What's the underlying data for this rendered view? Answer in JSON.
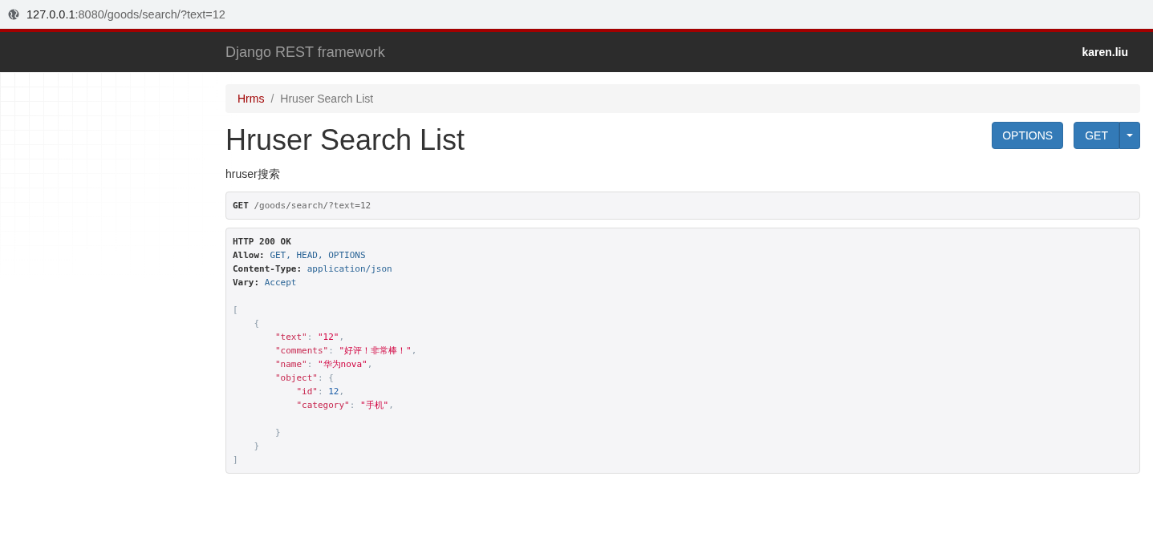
{
  "address_bar": {
    "host": "127.0.0.1",
    "path": ":8080/goods/search/?text=12"
  },
  "navbar": {
    "brand": "Django REST framework",
    "user": "karen.liu"
  },
  "breadcrumb": {
    "separator": "/",
    "items": [
      {
        "label": "Hrms",
        "selected": false
      },
      {
        "label": "Hruser Search List",
        "selected": true
      }
    ]
  },
  "page": {
    "title": "Hruser Search List",
    "description": "hruser搜索"
  },
  "buttons": [
    {
      "label": "OPTIONS",
      "kind": "plain"
    },
    {
      "label": "GET",
      "kind": "split"
    }
  ],
  "request": {
    "method": "GET",
    "path": "/goods/search/?text=12"
  },
  "response": {
    "status": "HTTP 200 OK",
    "headers": [
      {
        "name": "Allow:",
        "value": "GET, HEAD, OPTIONS"
      },
      {
        "name": "Content-Type:",
        "value": "application/json"
      },
      {
        "name": "Vary:",
        "value": "Accept"
      }
    ],
    "body_blocks": [
      [
        [
          {
            "kind": "punct",
            "text": "["
          }
        ],
        [
          {
            "kind": "punct",
            "text": "    {"
          }
        ],
        [
          {
            "kind": "key",
            "text": "        \"text\""
          },
          {
            "kind": "punct",
            "text": ": "
          },
          {
            "kind": "string",
            "text": "\"12\""
          },
          {
            "kind": "punct",
            "text": ","
          }
        ],
        [
          {
            "kind": "key",
            "text": "        \"comments\""
          },
          {
            "kind": "punct",
            "text": ": "
          },
          {
            "kind": "string",
            "text": "\"好评！非常棒！\""
          },
          {
            "kind": "punct",
            "text": ","
          }
        ],
        [
          {
            "kind": "key",
            "text": "        \"name\""
          },
          {
            "kind": "punct",
            "text": ": "
          },
          {
            "kind": "string",
            "text": "\"华为nova\""
          },
          {
            "kind": "punct",
            "text": ","
          }
        ],
        [
          {
            "kind": "key",
            "text": "        \"object\""
          },
          {
            "kind": "punct",
            "text": ": {"
          }
        ],
        [
          {
            "kind": "key",
            "text": "            \"id\""
          },
          {
            "kind": "punct",
            "text": ": "
          },
          {
            "kind": "number",
            "text": "12"
          },
          {
            "kind": "punct",
            "text": ","
          }
        ],
        [
          {
            "kind": "key",
            "text": "            \"category\""
          },
          {
            "kind": "punct",
            "text": ": "
          },
          {
            "kind": "string",
            "text": "\"手机\""
          },
          {
            "kind": "punct",
            "text": ","
          }
        ]
      ],
      [
        [
          {
            "kind": "punct",
            "text": "        }"
          }
        ],
        [
          {
            "kind": "punct",
            "text": "    }"
          }
        ],
        [
          {
            "kind": "punct",
            "text": "]"
          }
        ]
      ]
    ]
  }
}
